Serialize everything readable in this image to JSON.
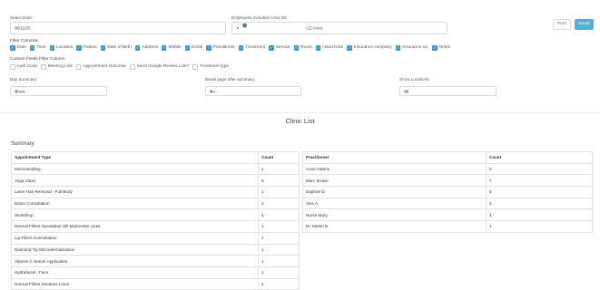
{
  "filters": {
    "date_label": "Select Date:",
    "date_value": "06/11/25",
    "employees_label": "Employees included in the list",
    "employees_more": "+22 more",
    "avatar_colors": [
      "#b08b6e",
      "#8a6a52",
      "#c4a080",
      "#6e5645",
      "#d2b59a",
      "#9a7b63",
      "#7d8fa3",
      "#c8a48a",
      "#5f4a3c",
      "#a98c74",
      "#bfa38d",
      "#d8c0a8",
      "#4a7f9e"
    ],
    "print_label": "Print",
    "email_label": "Email"
  },
  "filter_columns": {
    "label": "Filter Columns",
    "items": [
      {
        "label": "Date",
        "checked": true
      },
      {
        "label": "Time",
        "checked": true
      },
      {
        "label": "Location",
        "checked": true
      },
      {
        "label": "Patient",
        "checked": true
      },
      {
        "label": "Date of Birth",
        "checked": true
      },
      {
        "label": "Address",
        "checked": true
      },
      {
        "label": "Mobile",
        "checked": true
      },
      {
        "label": "Email",
        "checked": true
      },
      {
        "label": "Practitioner",
        "checked": true
      },
      {
        "label": "Treatment",
        "checked": true
      },
      {
        "label": "Service",
        "checked": true
      },
      {
        "label": "Room",
        "checked": true
      },
      {
        "label": "Hand Note",
        "checked": true
      },
      {
        "label": "Insurance company",
        "checked": true
      },
      {
        "label": "Insurance no.",
        "checked": true
      },
      {
        "label": "Notes",
        "checked": true
      }
    ]
  },
  "custom_fields": {
    "label": "Custom Fields Filter Column",
    "items": [
      {
        "label": "Auth Code",
        "checked": false
      },
      {
        "label": "Meeting Link",
        "checked": false
      },
      {
        "label": "Appointment Outcome",
        "checked": false
      },
      {
        "label": "Send Google Review Link?",
        "checked": false
      },
      {
        "label": "Treatment type",
        "checked": false
      }
    ]
  },
  "selects": {
    "day_summary_label": "Day Summary:",
    "day_summary_value": "Show",
    "break_page_label": "Break page after summary:",
    "break_page_value": "No",
    "locations_label": "Show Locations:",
    "locations_value": "All"
  },
  "report": {
    "title": "Clinic List",
    "summary_label": "Summary",
    "appointment_table": {
      "headers": [
        "Appointment Type",
        "Count"
      ],
      "rows": [
        [
          "Microneedling",
          "1"
        ],
        [
          "Yoga Class",
          "8"
        ],
        [
          "Laser Hair Removal - Full Body",
          "1"
        ],
        [
          "Botox Consultation",
          "2"
        ],
        [
          "Workshop",
          "4"
        ],
        [
          "Dermal Fillers Nasolabial OR Marionette Lines",
          "1"
        ],
        [
          "Lip Fillers Consultation",
          "1"
        ],
        [
          "Diamond Tip Microdermabrasion",
          "1"
        ],
        [
          "Vitamin C Serum Application",
          "1"
        ],
        [
          "Hydrafacial - Face",
          "1"
        ],
        [
          "Dermal Fillers Smokers Lines",
          "1"
        ]
      ]
    },
    "practitioner_table": {
      "headers": [
        "Practitioner",
        "Count"
      ],
      "rows": [
        [
          "Anna Adams",
          "8"
        ],
        [
          "Marc Brown",
          "7"
        ],
        [
          "Daphne D.",
          "5"
        ],
        [
          "Alex A.",
          "3"
        ],
        [
          "Nurse Mary",
          "4"
        ],
        [
          "Dr. Martin B",
          "1"
        ]
      ]
    }
  }
}
